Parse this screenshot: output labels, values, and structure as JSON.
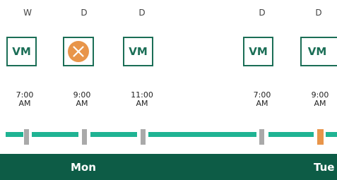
{
  "colors": {
    "tile_border": "#1b6e56",
    "error_fill": "#e8954a",
    "track": "#1fb393",
    "tick_normal": "#a9a9a9",
    "tick_error": "#e8954a",
    "day_bar": "#0d5c46"
  },
  "timeline": {
    "entries": [
      {
        "type": "W",
        "tile": "VM",
        "status": "ok",
        "time_line1": "7:00",
        "time_line2": "AM"
      },
      {
        "type": "D",
        "tile": "",
        "status": "error",
        "icon": "error-x-icon",
        "time_line1": "9:00",
        "time_line2": "AM"
      },
      {
        "type": "D",
        "tile": "VM",
        "status": "ok",
        "time_line1": "11:00",
        "time_line2": "AM"
      },
      {
        "type": "D",
        "tile": "VM",
        "status": "ok",
        "time_line1": "7:00",
        "time_line2": "AM"
      },
      {
        "type": "D",
        "tile": "VM",
        "status": "ok",
        "time_line1": "9:00",
        "time_line2": "AM"
      }
    ]
  },
  "days": {
    "mon": "Mon",
    "tue": "Tue"
  }
}
